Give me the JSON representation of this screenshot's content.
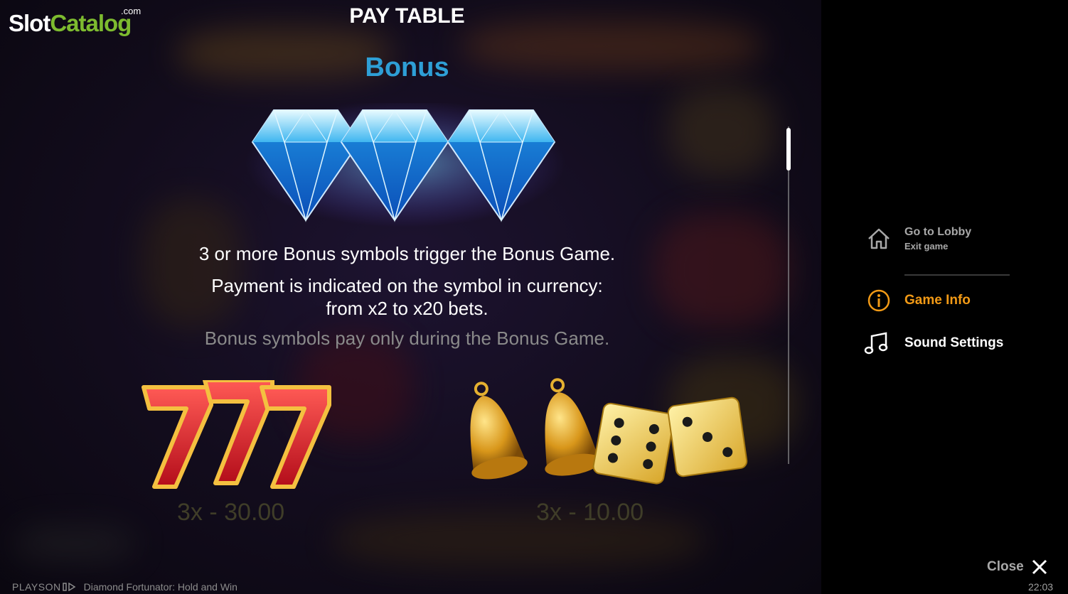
{
  "logo": {
    "slot": "Slot",
    "catalog": "Catalog",
    "com": ".com"
  },
  "paytable": {
    "title": "PAY TABLE",
    "section_heading": "Bonus",
    "line1": "3 or more Bonus symbols trigger the Bonus Game.",
    "line2a": "Payment is indicated on the symbol in currency:",
    "line2b": "from x2 to x20 bets.",
    "line3": "Bonus symbols pay only during the Bonus Game.",
    "pays": [
      {
        "label": "3x - 30.00",
        "symbol": "sevens"
      },
      {
        "label": "3x - 10.00",
        "symbol": "bells-and-dice"
      }
    ]
  },
  "menu": {
    "lobby": {
      "label": "Go to Lobby",
      "sublabel": "Exit game",
      "icon": "home-icon"
    },
    "info": {
      "label": "Game Info",
      "icon": "info-icon"
    },
    "sound": {
      "label": "Sound Settings",
      "icon": "music-note-icon"
    },
    "close": {
      "label": "Close",
      "icon": "close-icon"
    }
  },
  "footer": {
    "brand": "PLAYSON",
    "game_name": "Diamond Fortunator: Hold and Win",
    "clock": "22:03"
  },
  "colors": {
    "bonus_heading": "#2e9fd6",
    "active_menu": "#f29a16",
    "logo_green": "#7dbb2f"
  }
}
